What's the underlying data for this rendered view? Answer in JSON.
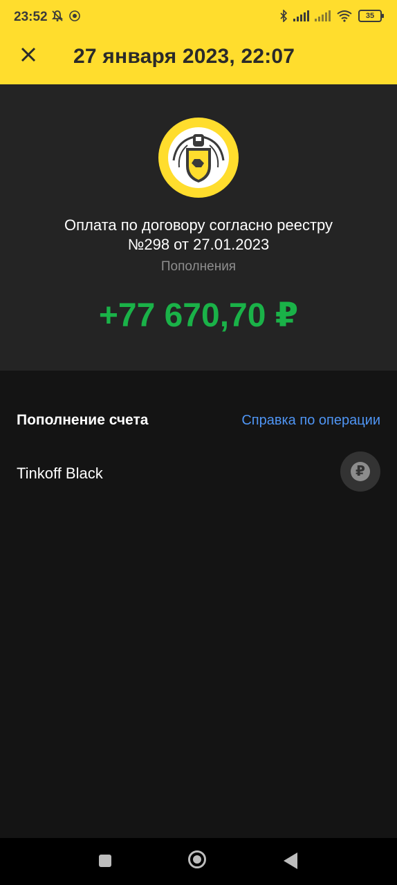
{
  "status_bar": {
    "time": "23:52",
    "battery": "35",
    "icons": [
      "bell-muted-icon",
      "app-icon",
      "bluetooth-icon",
      "signal-icon",
      "signal-icon",
      "wifi-icon",
      "battery-icon"
    ]
  },
  "header": {
    "title": "27 января 2023, 22:07",
    "close_icon": "close-icon",
    "background": "#ffdd2d"
  },
  "operation": {
    "description": "Оплата по договору согласно реестру №298 от 27.01.2023",
    "category": "Пополнения",
    "amount": "+77 670,70 ₽",
    "amount_color": "#1ab248"
  },
  "details": {
    "section_title": "Пополнение счета",
    "help_link": "Справка по операции",
    "account_name": "Tinkoff Black",
    "account_icon": "₽"
  },
  "nav_bar": {
    "items": [
      "recents-icon",
      "home-icon",
      "back-icon"
    ]
  }
}
